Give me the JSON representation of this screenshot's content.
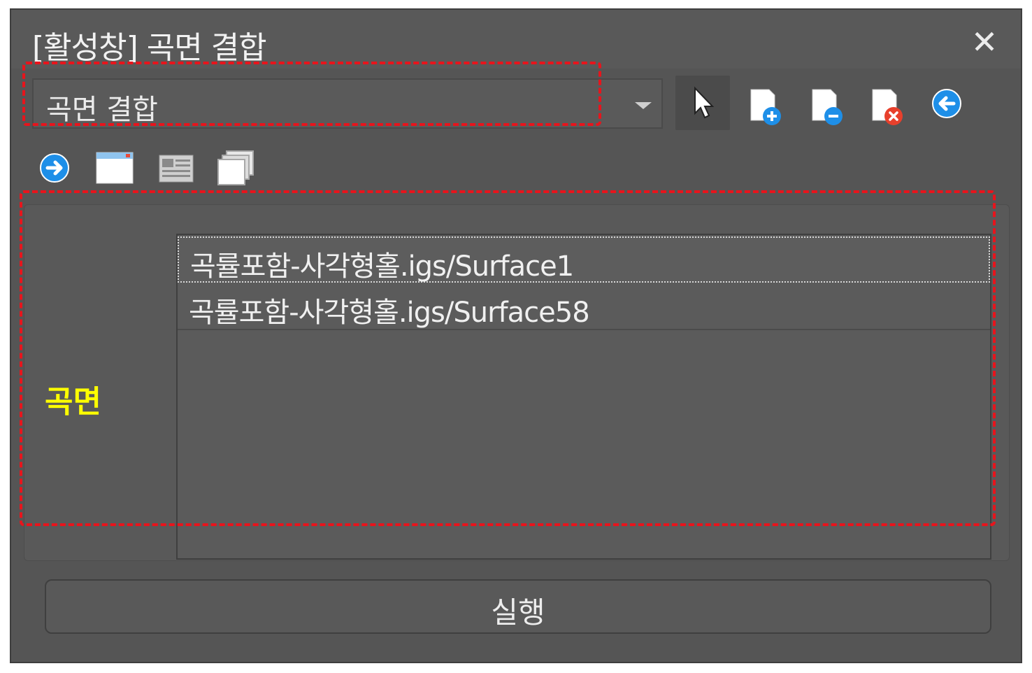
{
  "window": {
    "title": "[활성창] 곡면 결합",
    "close_label": "✕"
  },
  "command_combo": {
    "value": "곡면 결합"
  },
  "toolbar": {
    "icons": [
      "pointer-select-icon",
      "add-document-icon",
      "remove-document-icon",
      "delete-document-icon",
      "arrow-left-icon",
      "arrow-right-icon",
      "window-icon",
      "list-view-icon",
      "layered-windows-icon"
    ]
  },
  "surface_panel": {
    "label": "곡면",
    "items": [
      {
        "label": "곡률포함-사각형홀.igs/Surface1",
        "selected": true
      },
      {
        "label": "곡률포함-사각형홀.igs/Surface58",
        "selected": false
      }
    ]
  },
  "actions": {
    "run_label": "실행"
  },
  "colors": {
    "window_bg": "#555555",
    "label_highlight": "#ffff00",
    "annotation_red": "#e8141c",
    "icon_blue": "#1e8fe8"
  }
}
